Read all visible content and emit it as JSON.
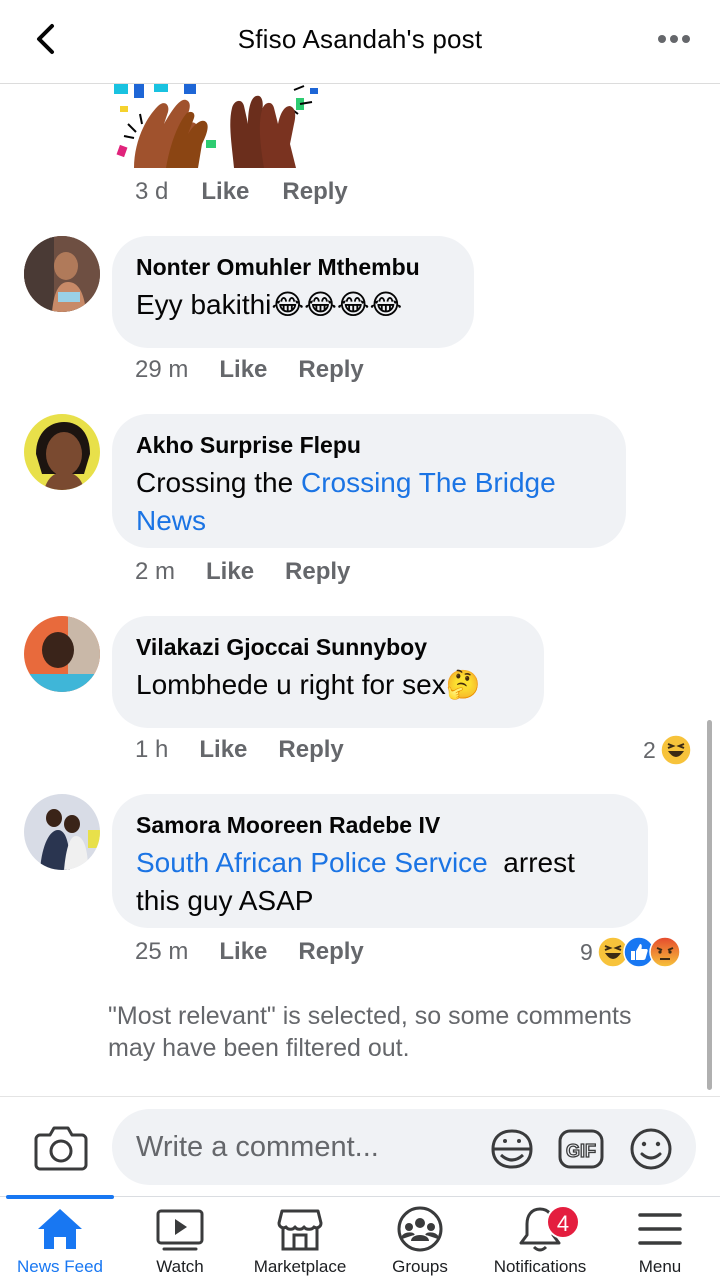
{
  "header": {
    "title": "Sfiso Asandah's post"
  },
  "first_comment_meta": {
    "time": "3 d",
    "like": "Like",
    "reply": "Reply"
  },
  "comments": [
    {
      "author": "Nonter Omuhler Mthembu",
      "text": "Eyy bakithi😂😂😂😂",
      "time": "29 m",
      "like": "Like",
      "reply": "Reply"
    },
    {
      "author": "Akho Surprise Flepu",
      "text_prefix": "Crossing the ",
      "link": "Crossing The Bridge News",
      "time": "2 m",
      "like": "Like",
      "reply": "Reply"
    },
    {
      "author": "Vilakazi Gjoccai Sunnyboy",
      "text": "Lombhede u right for sex🤔",
      "time": "1 h",
      "like": "Like",
      "reply": "Reply",
      "reaction_count": "2"
    },
    {
      "author": "Samora Mooreen Radebe IV",
      "link": "South African Police Service",
      "text_suffix": "  arrest this guy ASAP",
      "time": "25 m",
      "like": "Like",
      "reply": "Reply",
      "reaction_count": "9"
    }
  ],
  "filter_note": "\"Most relevant\" is selected, so some comments may have been filtered out.",
  "composer": {
    "placeholder": "Write a comment..."
  },
  "tabs": [
    {
      "label": "News Feed",
      "icon": "home-icon",
      "active": true
    },
    {
      "label": "Watch",
      "icon": "watch-icon"
    },
    {
      "label": "Marketplace",
      "icon": "marketplace-icon"
    },
    {
      "label": "Groups",
      "icon": "groups-icon"
    },
    {
      "label": "Notifications",
      "icon": "bell-icon",
      "badge": "4"
    },
    {
      "label": "Menu",
      "icon": "menu-icon"
    }
  ],
  "colors": {
    "accent": "#1877f2",
    "link": "#1b74e4",
    "bubble": "#f0f2f5",
    "meta": "#65676b",
    "badge": "#e41e3f"
  }
}
